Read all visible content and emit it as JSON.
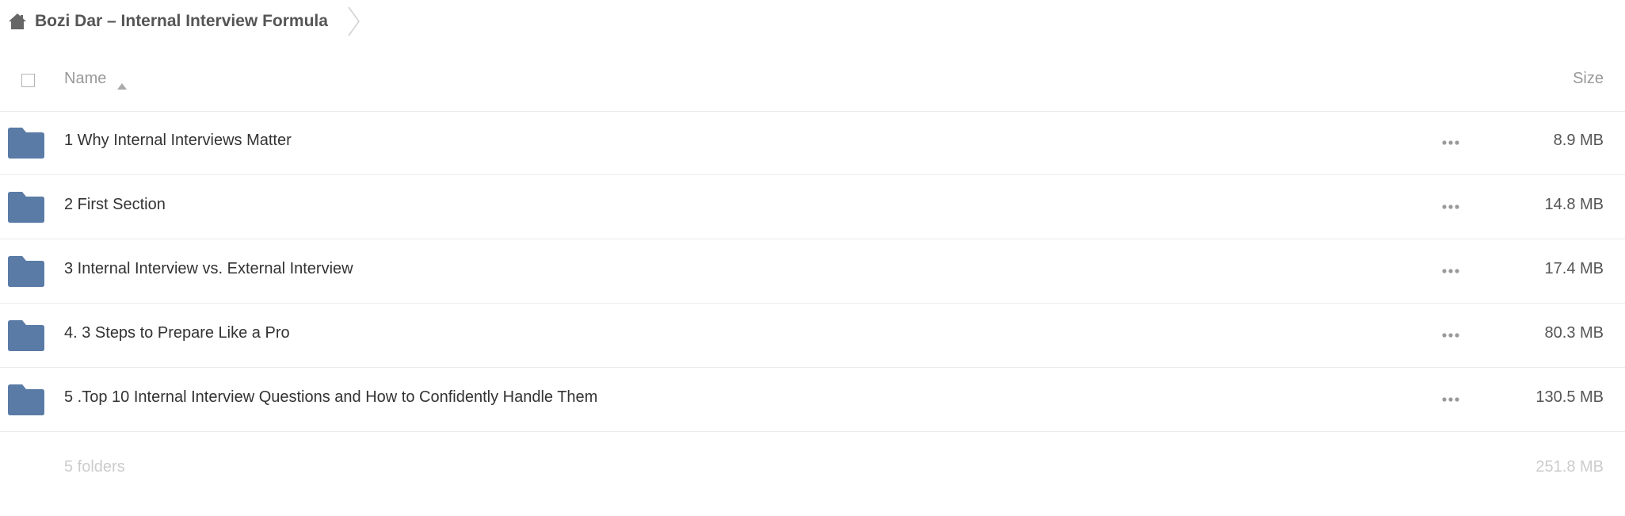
{
  "breadcrumb": {
    "home_icon": "home-icon",
    "label": "Bozi Dar – Internal Interview Formula",
    "separator_icon": "chevron-right-icon"
  },
  "table": {
    "header": {
      "name_label": "Name",
      "sort_icon": "sort-ascending-icon",
      "size_label": "Size"
    },
    "rows": [
      {
        "icon": "folder-icon",
        "name": "1 Why Internal Interviews Matter",
        "size": "8.9 MB",
        "more_icon": "more-horizontal-icon"
      },
      {
        "icon": "folder-icon",
        "name": "2 First Section",
        "size": "14.8 MB",
        "more_icon": "more-horizontal-icon"
      },
      {
        "icon": "folder-icon",
        "name": "3 Internal Interview vs. External Interview",
        "size": "17.4 MB",
        "more_icon": "more-horizontal-icon"
      },
      {
        "icon": "folder-icon",
        "name": "4. 3 Steps to Prepare Like a Pro",
        "size": "80.3 MB",
        "more_icon": "more-horizontal-icon"
      },
      {
        "icon": "folder-icon",
        "name": "5 .Top 10 Internal Interview Questions and How to Confidently Handle Them",
        "size": "130.5 MB",
        "more_icon": "more-horizontal-icon"
      }
    ],
    "summary": {
      "count": "5 folders",
      "total_size": "251.8 MB"
    }
  },
  "colors": {
    "folder": "#5a7ba6",
    "muted_text": "#999999",
    "faint_text": "#cccccc",
    "divider": "#ebebeb"
  }
}
